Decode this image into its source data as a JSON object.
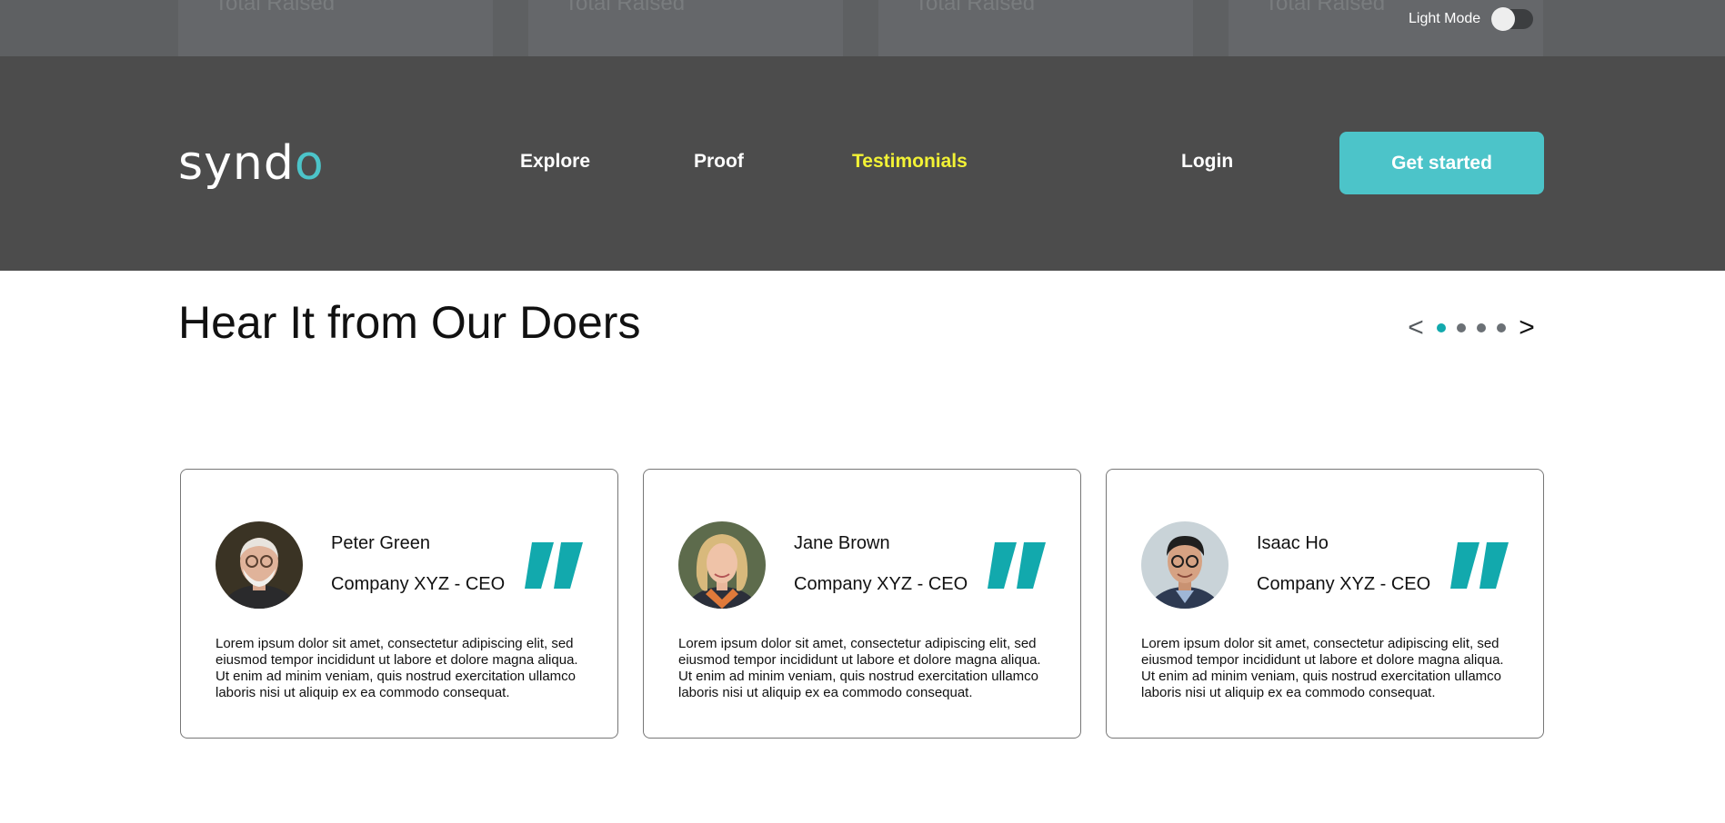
{
  "stats": {
    "card_label": "Total Raised"
  },
  "theme_toggle": {
    "label": "Light Mode",
    "state": "off"
  },
  "header": {
    "logo": {
      "main": "synd",
      "accent": "o"
    },
    "nav": [
      {
        "label": "Explore",
        "active": false
      },
      {
        "label": "Proof",
        "active": false
      },
      {
        "label": "Testimonials",
        "active": true
      }
    ],
    "login": "Login",
    "cta": "Get started"
  },
  "colors": {
    "accent": "#4cc4c9",
    "active_nav": "#f2f235",
    "header_bg": "#4c4c4c",
    "quote": "#12a9ad"
  },
  "section": {
    "title": "Hear It from Our Doers",
    "carousel": {
      "prev": "<",
      "next": ">",
      "dots": 4,
      "active_index": 0
    }
  },
  "testimonials": [
    {
      "name": "Peter Green",
      "role": "Company XYZ - CEO",
      "text": "Lorem ipsum dolor sit amet, consectetur adipiscing elit, sed eiusmod tempor incididunt ut labore et dolore magna aliqua. Ut enim ad minim veniam, quis nostrud exercitation ullamco laboris nisi ut aliquip ex ea commodo consequat.",
      "icon": "quote-icon"
    },
    {
      "name": "Jane Brown",
      "role": "Company XYZ - CEO",
      "text": "Lorem ipsum dolor sit amet, consectetur adipiscing elit, sed eiusmod tempor incididunt ut labore et dolore magna aliqua. Ut enim ad minim veniam, quis nostrud exercitation ullamco laboris nisi ut aliquip ex ea commodo consequat.",
      "icon": "quote-icon"
    },
    {
      "name": "Isaac Ho",
      "role": "Company XYZ - CEO",
      "text": "Lorem ipsum dolor sit amet, consectetur adipiscing elit, sed eiusmod tempor incididunt ut labore et dolore magna aliqua. Ut enim ad minim veniam, quis nostrud exercitation ullamco laboris nisi ut aliquip ex ea commodo consequat.",
      "icon": "quote-icon"
    }
  ]
}
